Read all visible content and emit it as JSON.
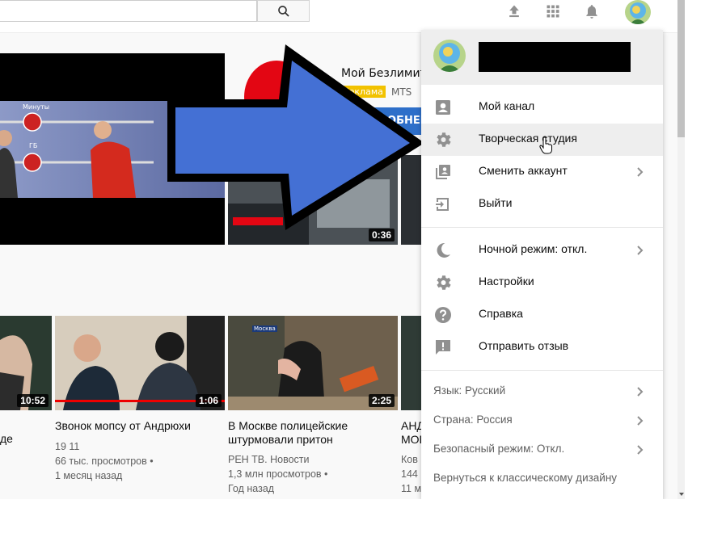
{
  "masthead": {
    "icons": [
      "search-icon",
      "upload-icon",
      "apps-icon",
      "notifications-icon"
    ]
  },
  "featured": {
    "ad_title": "Мой Безлимит",
    "ad_badge": "Реклама",
    "ad_advertiser": "MTS",
    "ad_button": "ПОДРОБНЕЕ",
    "small_video_duration": "0:36",
    "tv_label_minutes": "Минуты",
    "tv_label_gb": "ГБ"
  },
  "videos": [
    {
      "title_partial": "де",
      "duration": "10:52"
    },
    {
      "title": "Звонок мопсу от Андрюхи",
      "channel": "19 11",
      "views": "66 тыс. просмотров",
      "age": "1 месяц назад",
      "duration": "1:06"
    },
    {
      "title_line1": "В Москве полицейские",
      "title_line2": "штурмовали притон",
      "channel": "РЕН ТВ. Новости",
      "views": "1,3 млн просмотров",
      "age": "Год назад",
      "duration": "2:25",
      "overlay_label": "Москва"
    },
    {
      "title_line1": "АНД",
      "title_line2": "МОЕ",
      "channel": "Ков",
      "views": "144",
      "age": "11 м"
    }
  ],
  "menu": {
    "items": [
      {
        "label": "Мой канал",
        "icon": "account-icon"
      },
      {
        "label": "Творческая студия",
        "icon": "gear-icon"
      },
      {
        "label": "Сменить аккаунт",
        "icon": "switch-account-icon"
      },
      {
        "label": "Выйти",
        "icon": "sign-out-icon"
      }
    ],
    "items2": [
      {
        "label": "Ночной режим: откл.",
        "icon": "moon-icon"
      },
      {
        "label": "Настройки",
        "icon": "gear-icon"
      },
      {
        "label": "Справка",
        "icon": "help-icon"
      },
      {
        "label": "Отправить отзыв",
        "icon": "feedback-icon"
      }
    ],
    "items3": [
      {
        "label": "Язык: Русский"
      },
      {
        "label": "Страна: Россия"
      },
      {
        "label": "Безопасный режим: Откл."
      },
      {
        "label": "Вернуться к классическому дизайну"
      }
    ]
  },
  "colors": {
    "arrow": "#4a7ae6",
    "ad_red": "#e30613",
    "badge_yellow": "#f2c200",
    "menu_hover": "#eeeeee"
  }
}
